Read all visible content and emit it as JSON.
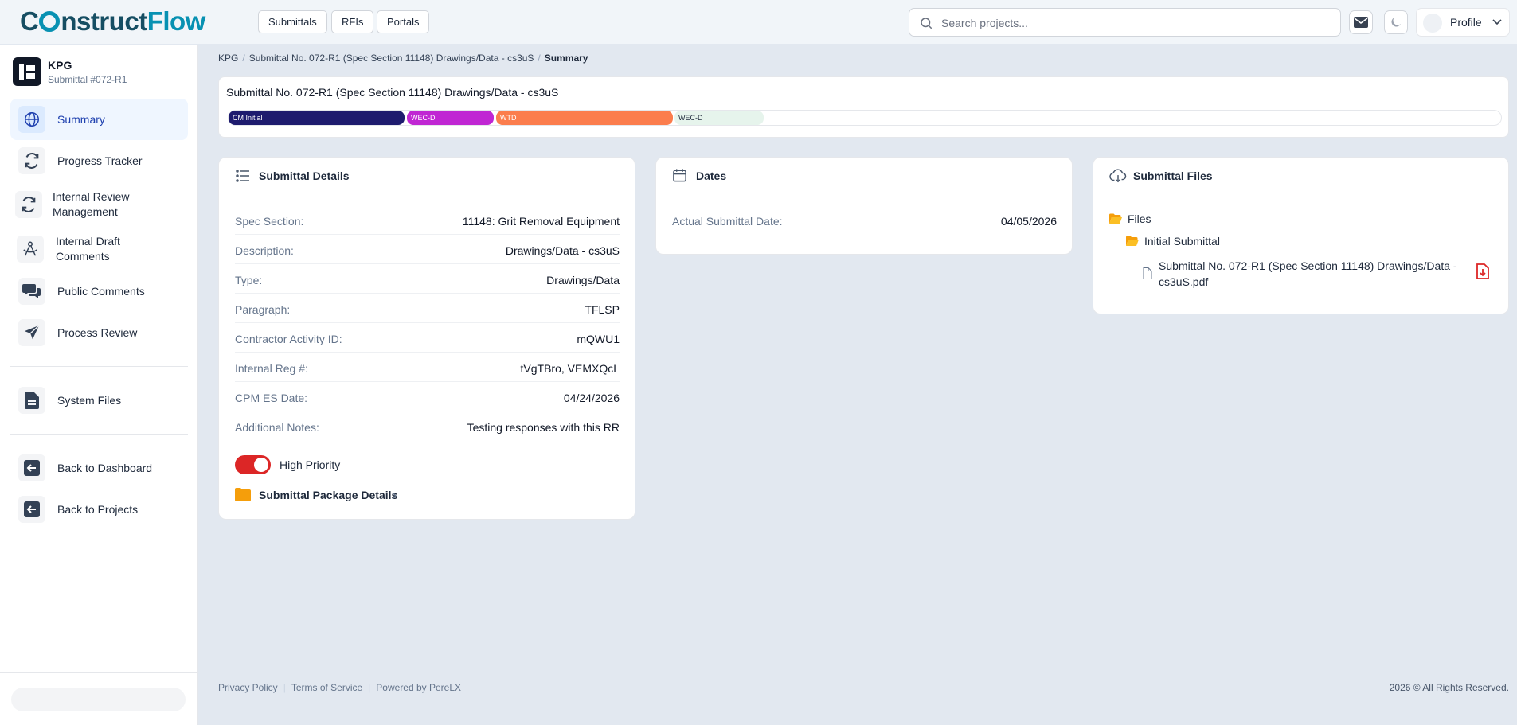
{
  "app": {
    "logo_text_a": "C",
    "logo_text_b": "nstruct",
    "logo_text_c": "Flow"
  },
  "topnav": {
    "items": [
      "Submittals",
      "RFIs",
      "Portals"
    ],
    "search_placeholder": "Search projects...",
    "profile_label": "Profile"
  },
  "project": {
    "name": "KPG",
    "subtitle": "Submittal #072-R1"
  },
  "sidebar": {
    "items": [
      {
        "label": "Summary",
        "icon": "globe-icon",
        "active": true
      },
      {
        "label": "Progress Tracker",
        "icon": "refresh-icon"
      },
      {
        "label": "Internal Review Management",
        "icon": "refresh-icon"
      },
      {
        "label": "Internal Draft Comments",
        "icon": "compass-icon"
      },
      {
        "label": "Public Comments",
        "icon": "comments-icon"
      },
      {
        "label": "Process Review",
        "icon": "paper-plane-icon"
      },
      {
        "label": "System Files",
        "icon": "file-icon"
      },
      {
        "label": "Back to Dashboard",
        "icon": "arrow-left-box-icon"
      },
      {
        "label": "Back to Projects",
        "icon": "arrow-left-box-icon"
      }
    ]
  },
  "breadcrumb": {
    "items": [
      "KPG",
      "Submittal No. 072-R1 (Spec Section 11148) Drawings/Data - cs3uS",
      "Summary"
    ]
  },
  "header": {
    "title": "Submittal No. 072-R1 (Spec Section 11148) Drawings/Data - cs3uS",
    "stages": [
      {
        "label": "CM Initial",
        "color": "#1e1b6e",
        "text_color": "#ffffff"
      },
      {
        "label": "WEC-D",
        "color": "#c026d3",
        "text_color": "#ffffff"
      },
      {
        "label": "WTD",
        "color": "#fb7d4d",
        "text_color": "#ffffff"
      },
      {
        "label": "WEC-D",
        "color": "#e6f4ec",
        "text_color": "#1e293b"
      }
    ]
  },
  "details": {
    "title": "Submittal Details",
    "rows": [
      {
        "label": "Spec Section:",
        "value": "11148: Grit Removal Equipment"
      },
      {
        "label": "Description:",
        "value": "Drawings/Data - cs3uS"
      },
      {
        "label": "Type:",
        "value": "Drawings/Data"
      },
      {
        "label": "Paragraph:",
        "value": "TFLSP"
      },
      {
        "label": "Contractor Activity ID:",
        "value": "mQWU1"
      },
      {
        "label": "Internal Reg #:",
        "value": "tVgTBro, VEMXQcL"
      },
      {
        "label": "CPM ES Date:",
        "value": "04/24/2026"
      },
      {
        "label": "Additional Notes:",
        "value": "Testing responses with this RR"
      }
    ],
    "high_priority_label": "High Priority",
    "high_priority_on": true,
    "package_label": "Submittal Package Details"
  },
  "dates": {
    "title": "Dates",
    "rows": [
      {
        "label": "Actual Submittal Date:",
        "value": "04/05/2026"
      }
    ]
  },
  "files": {
    "title": "Submittal Files",
    "root": "Files",
    "folder": "Initial Submittal",
    "file_line1": "Submittal No. 072-R1 (Spec Section 11148) Drawings/Data -",
    "file_line2": "cs3uS.pdf"
  },
  "footer": {
    "links": [
      "Privacy Policy",
      "Terms of Service",
      "Powered by PereLX"
    ],
    "copyright": "2026 © All Rights Reserved."
  },
  "colors": {
    "accent": "#1e40af",
    "priority_toggle": "#dc2626",
    "folder": "#f59e0b",
    "pdf_icon": "#dc2626"
  }
}
